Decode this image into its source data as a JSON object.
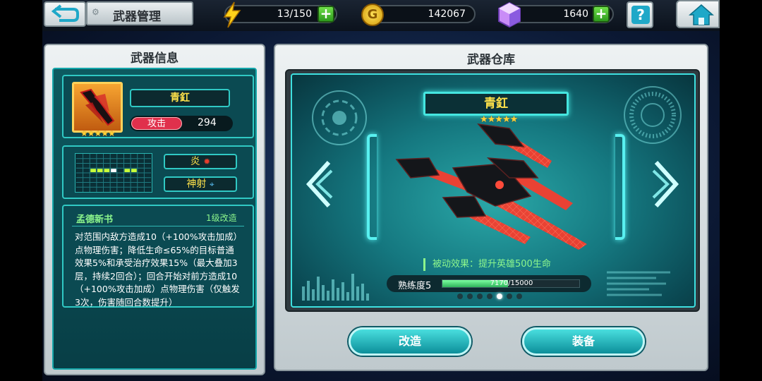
{
  "header": {
    "title": "武器管理",
    "energy": "13/150",
    "coins": "142067",
    "coin_symbol": "G",
    "gems": "1640",
    "plus": "+",
    "help": "?"
  },
  "info_panel": {
    "title": "武器信息",
    "weapon_name": "青釭",
    "stars": "★★★★★",
    "stat_label": "攻击",
    "stat_value": "294",
    "tag1": "炎",
    "tag2": "神射",
    "skill_name": "孟德新书",
    "skill_level": "1级改造",
    "skill_desc": "对范围内敌方造成10（+100%攻击加成）点物理伤害；降低生命≤65%的目标普通效果5%和承受治疗效果15%（最大叠加3层，持续2回合）；回合开始对前方造成10（+100%攻击加成）点物理伤害（仅触发3次，伤害随回合数提升）"
  },
  "warehouse": {
    "title": "武器仓库",
    "weapon_name": "青釭",
    "stars": "★★★★★",
    "passive": "被动效果：提升英雄500生命",
    "proficiency_label": "熟练度5",
    "proficiency_text": "7170/15000",
    "proficiency_progress": 0.478,
    "page_count": 7,
    "page_active": 5,
    "modify_button": "改造",
    "equip_button": "装备"
  },
  "colors": {
    "accent_cyan": "#39d8d8",
    "attack_red": "#e0304c",
    "progress_green": "#3fd36c",
    "weapon_red": "#ff3a2a"
  }
}
